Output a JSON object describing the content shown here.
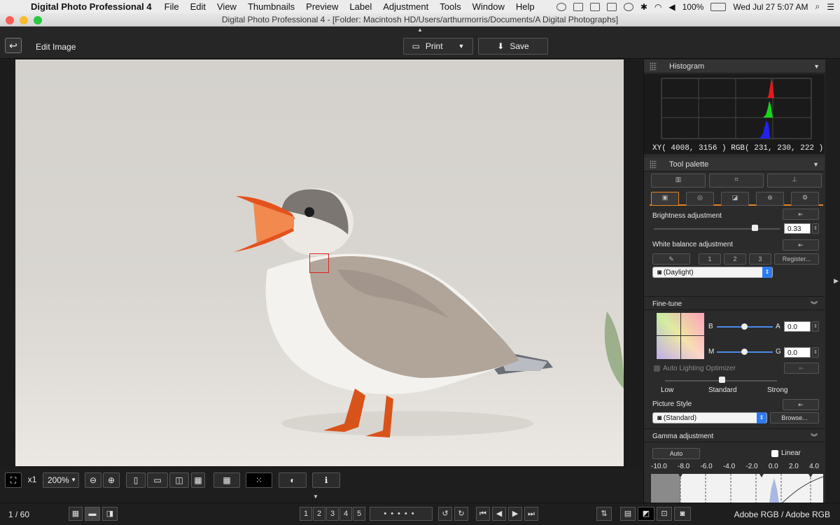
{
  "menubar": {
    "app_name": "Digital Photo Professional 4",
    "items": [
      "File",
      "Edit",
      "View",
      "Thumbnails",
      "Preview",
      "Label",
      "Adjustment",
      "Tools",
      "Window",
      "Help"
    ],
    "battery": "100%",
    "clock": "Wed Jul 27  5:07 AM"
  },
  "window": {
    "title": "Digital Photo Professional 4 - [Folder: Macintosh HD/Users/arthurmorris/Documents/A Digital Photographs]"
  },
  "toolbar": {
    "mode_title": "Edit Image",
    "print_label": "Print",
    "save_label": "Save"
  },
  "histogram": {
    "title": "Histogram",
    "readout": "XY(  4008,   3156 ) RGB( 231, 230, 222 )"
  },
  "tool_palette": {
    "title": "Tool palette",
    "brightness_label": "Brightness adjustment",
    "brightness_value": "0.33",
    "brightness_level": 0.8,
    "wb_label": "White balance adjustment",
    "wb_presets": [
      "1",
      "2",
      "3"
    ],
    "register_label": "Register...",
    "wb_selected": "(Daylight)",
    "finetune_title": "Fine-tune",
    "b_label": "B",
    "a_label": "A",
    "a_value": "0.0",
    "m_label": "M",
    "g_label": "G",
    "g_value": "0.0",
    "alo_label": "Auto Lighting Optimizer",
    "alo_levels": [
      "Low",
      "Standard",
      "Strong"
    ],
    "picture_style_label": "Picture Style",
    "picture_style_selected": "(Standard)",
    "browse_label": "Browse...",
    "gamma_title": "Gamma adjustment",
    "auto_label": "Auto",
    "linear_label": "Linear",
    "gamma_ticks": [
      "-10.0",
      "-8.0",
      "-6.0",
      "-4.0",
      "-2.0",
      "0.0",
      "2.0",
      "4.0"
    ]
  },
  "view_controls": {
    "x1_label": "x1",
    "zoom_value": "200%"
  },
  "status": {
    "page_counter": "1 / 60",
    "ratings": [
      "1",
      "2",
      "3",
      "4",
      "5"
    ],
    "color_space": "Adobe RGB / Adobe RGB"
  },
  "colors": {
    "accent_orange": "#e8821e",
    "selection_red": "#e02020",
    "select_blue": "#2d7bf0"
  }
}
